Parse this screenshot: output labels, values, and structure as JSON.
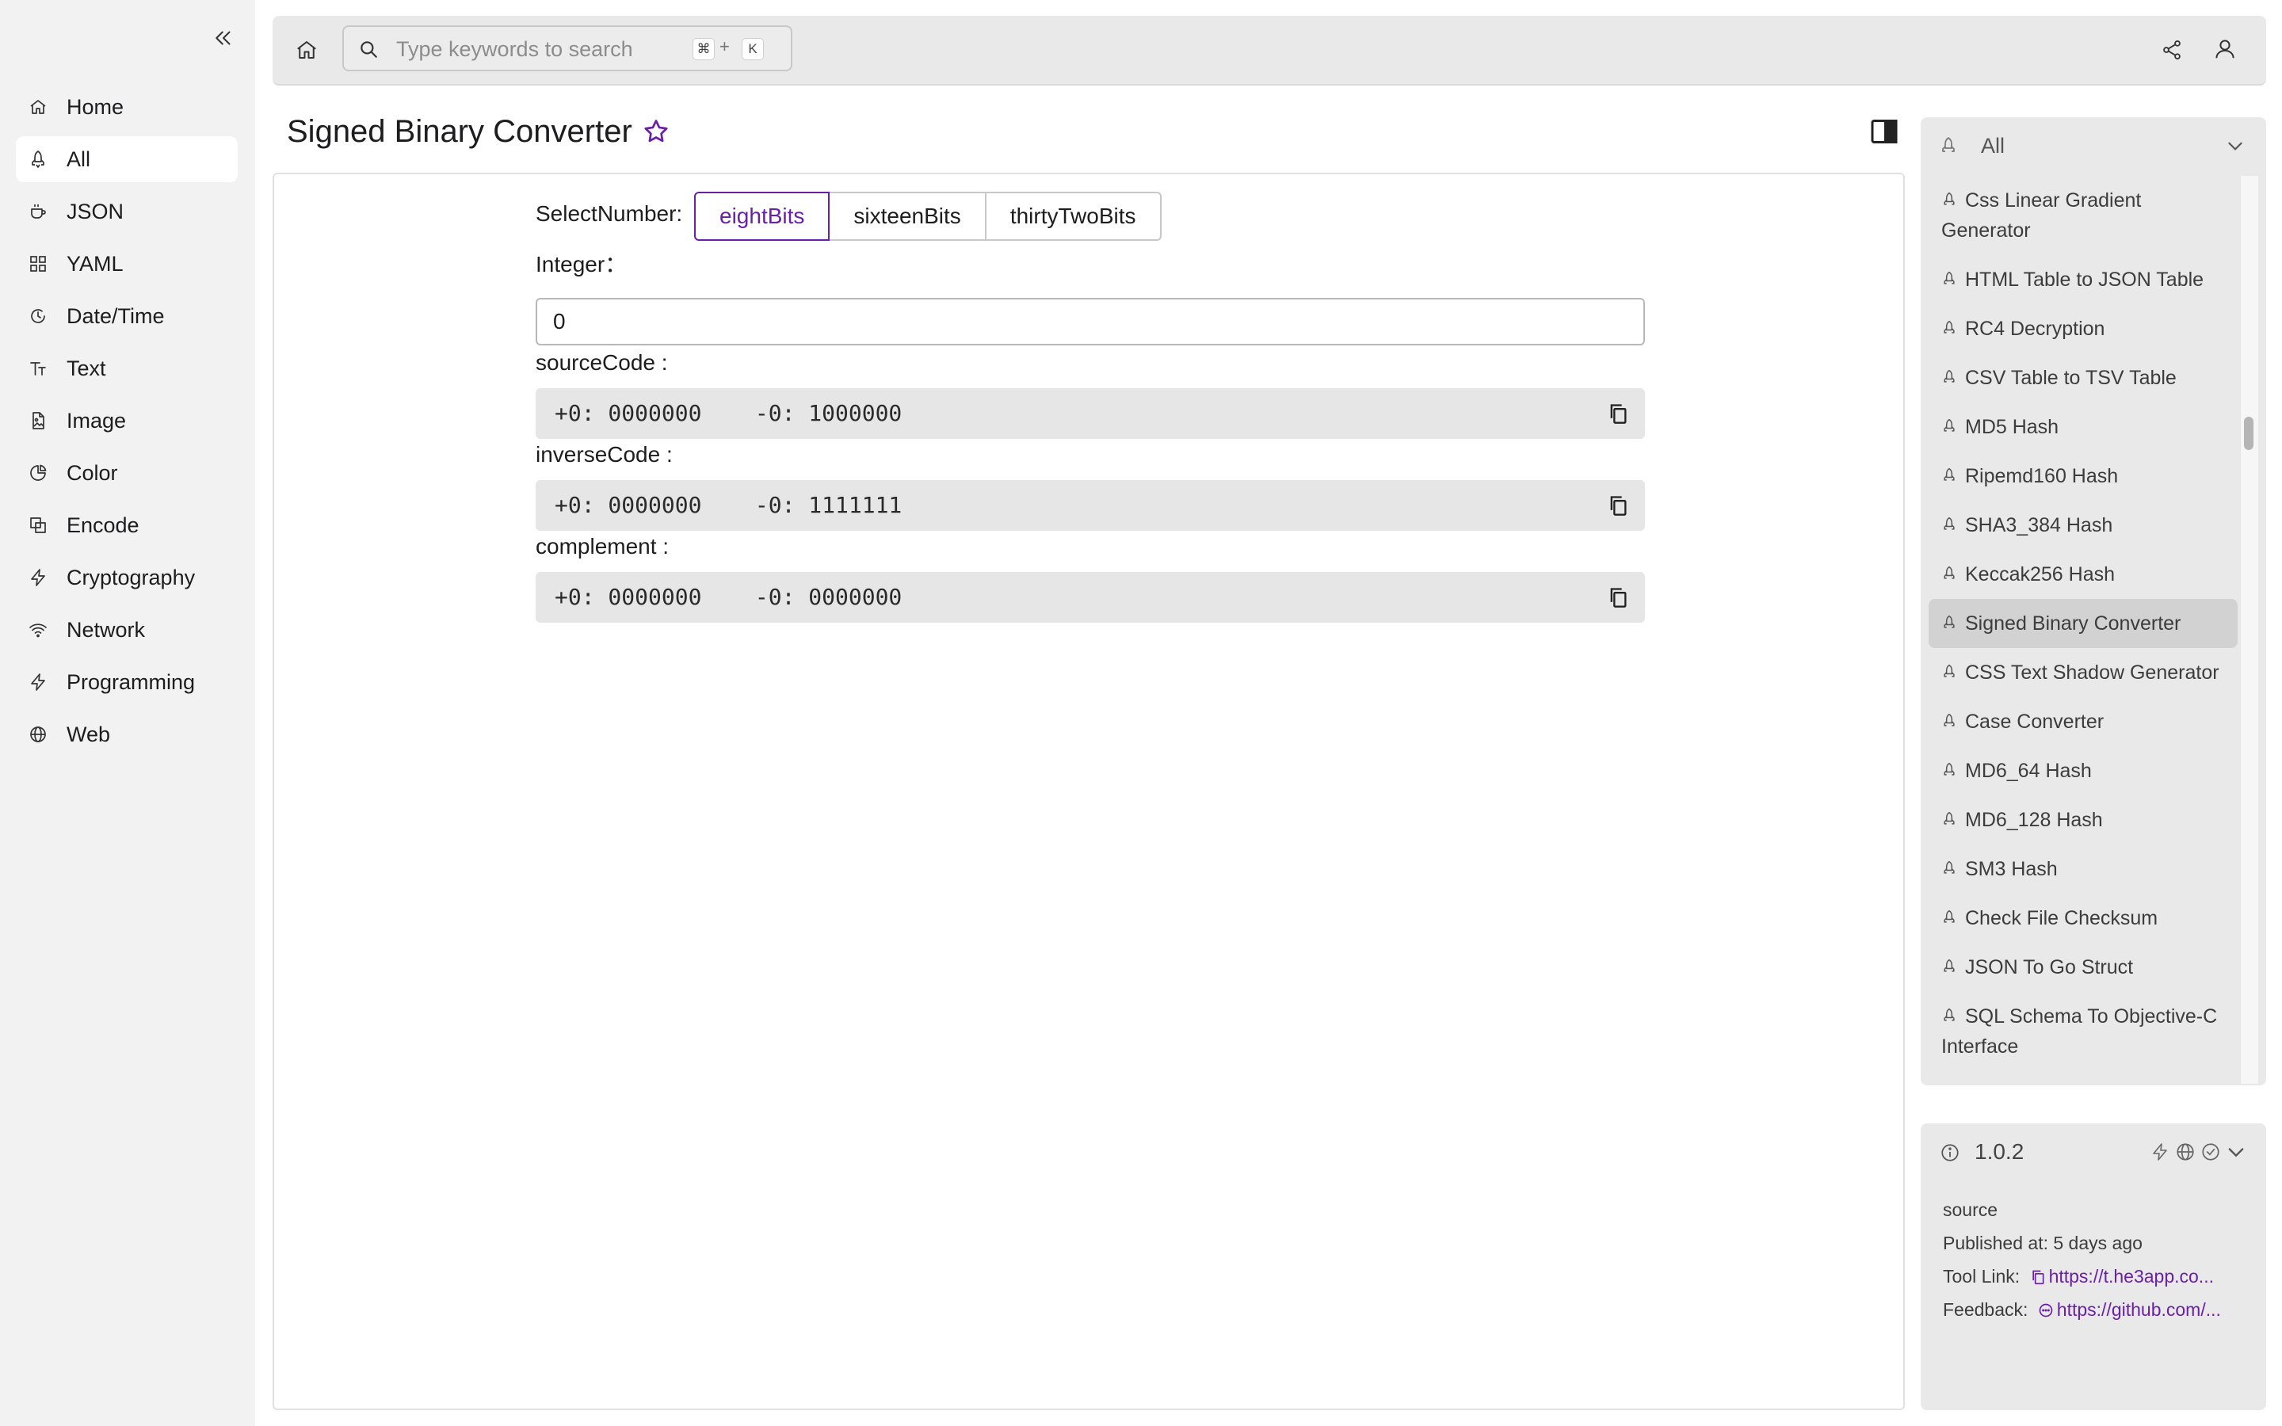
{
  "sidebar": {
    "collapse_icon": "double-chevron-left-icon",
    "items": [
      {
        "label": "Home",
        "icon": "home-icon"
      },
      {
        "label": "All",
        "icon": "rocket-icon",
        "active": true
      },
      {
        "label": "JSON",
        "icon": "coffee-icon"
      },
      {
        "label": "YAML",
        "icon": "grid-icon"
      },
      {
        "label": "Date/Time",
        "icon": "clock-icon"
      },
      {
        "label": "Text",
        "icon": "text-size-icon"
      },
      {
        "label": "Image",
        "icon": "image-file-icon"
      },
      {
        "label": "Color",
        "icon": "pie-icon"
      },
      {
        "label": "Encode",
        "icon": "layers-icon"
      },
      {
        "label": "Cryptography",
        "icon": "bolt-icon"
      },
      {
        "label": "Network",
        "icon": "wifi-icon"
      },
      {
        "label": "Programming",
        "icon": "bolt-icon"
      },
      {
        "label": "Web",
        "icon": "globe-icon"
      }
    ]
  },
  "topbar": {
    "search_placeholder": "Type keywords to search...",
    "shortcut_key1": "⌘",
    "shortcut_plus": "+",
    "shortcut_key2": "K"
  },
  "page": {
    "title": "Signed Binary Converter"
  },
  "converter": {
    "select_label": "SelectNumber:",
    "options": [
      "eightBits",
      "sixteenBits",
      "thirtyTwoBits"
    ],
    "selected": "eightBits",
    "integer_label": "Integer：",
    "integer_value": "0",
    "source_label": "sourceCode :",
    "source_value": "+0: 0000000    -0: 1000000",
    "inverse_label": "inverseCode :",
    "inverse_value": "+0: 0000000    -0: 1111111",
    "complement_label": "complement :",
    "complement_value": "+0: 0000000    -0: 0000000"
  },
  "tool_panel": {
    "filter_label": "All",
    "items": [
      {
        "label": "Css Linear Gradient Generator"
      },
      {
        "label": "HTML Table to JSON Table"
      },
      {
        "label": "RC4 Decryption"
      },
      {
        "label": "CSV Table to TSV Table"
      },
      {
        "label": "MD5 Hash"
      },
      {
        "label": "Ripemd160 Hash"
      },
      {
        "label": "SHA3_384 Hash"
      },
      {
        "label": "Keccak256 Hash"
      },
      {
        "label": "Signed Binary Converter",
        "active": true
      },
      {
        "label": "CSS Text Shadow Generator"
      },
      {
        "label": "Case Converter"
      },
      {
        "label": "MD6_64 Hash"
      },
      {
        "label": "MD6_128 Hash"
      },
      {
        "label": "SM3 Hash"
      },
      {
        "label": "Check File Checksum"
      },
      {
        "label": "JSON To Go Struct"
      },
      {
        "label": "SQL Schema To Objective-C Interface"
      }
    ]
  },
  "info": {
    "version": "1.0.2",
    "source": "source",
    "published": "Published at: 5 days ago",
    "tool_link_label": "Tool Link:",
    "tool_link": "https://t.he3app.co...",
    "feedback_label": "Feedback:",
    "feedback_link": "https://github.com/..."
  },
  "colors": {
    "accent": "#6a1fa8",
    "sidebar_bg": "#f2f2f2",
    "panel_bg": "#e9e9e9",
    "output_bg": "#e6e6e6"
  }
}
